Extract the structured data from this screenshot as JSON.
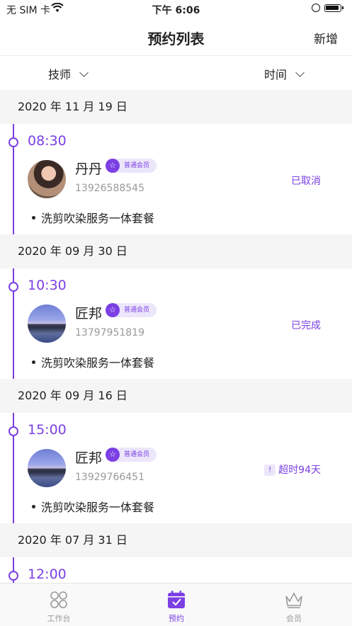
{
  "status_bar": {
    "carrier": "无 SIM 卡",
    "time": "下午 6:06"
  },
  "nav": {
    "title": "预约列表",
    "add_label": "新增"
  },
  "filters": [
    {
      "label": "技师"
    },
    {
      "label": "时间"
    }
  ],
  "groups": [
    {
      "date": "2020 年 11 月 19 日",
      "time": "08:30",
      "customer": "丹丹",
      "badge": "普通会员",
      "phone": "13926588545",
      "status": "已取消",
      "service": "洗剪吹染服务一体套餐",
      "avatar": "girl"
    },
    {
      "date": "2020 年 09 月 30 日",
      "time": "10:30",
      "customer": "匠邦",
      "badge": "普通会员",
      "phone": "13797951819",
      "status": "已完成",
      "service": "洗剪吹染服务一体套餐",
      "avatar": "city"
    },
    {
      "date": "2020 年 09 月 16 日",
      "time": "15:00",
      "customer": "匠邦",
      "badge": "普通会员",
      "phone": "13929766451",
      "status": "超时94天",
      "service": "洗剪吹染服务一体套餐",
      "avatar": "city"
    },
    {
      "date": "2020 年 07 月 31 日",
      "time": "12:00"
    }
  ],
  "tabs": [
    {
      "label": "工作台",
      "icon": "workbench-icon"
    },
    {
      "label": "预约",
      "icon": "calendar-check-icon"
    },
    {
      "label": "会员",
      "icon": "crown-icon"
    }
  ],
  "colors": {
    "accent": "#7b3fe4",
    "badge_bg": "#ece6fb",
    "page_bg": "#f5f5f5"
  }
}
